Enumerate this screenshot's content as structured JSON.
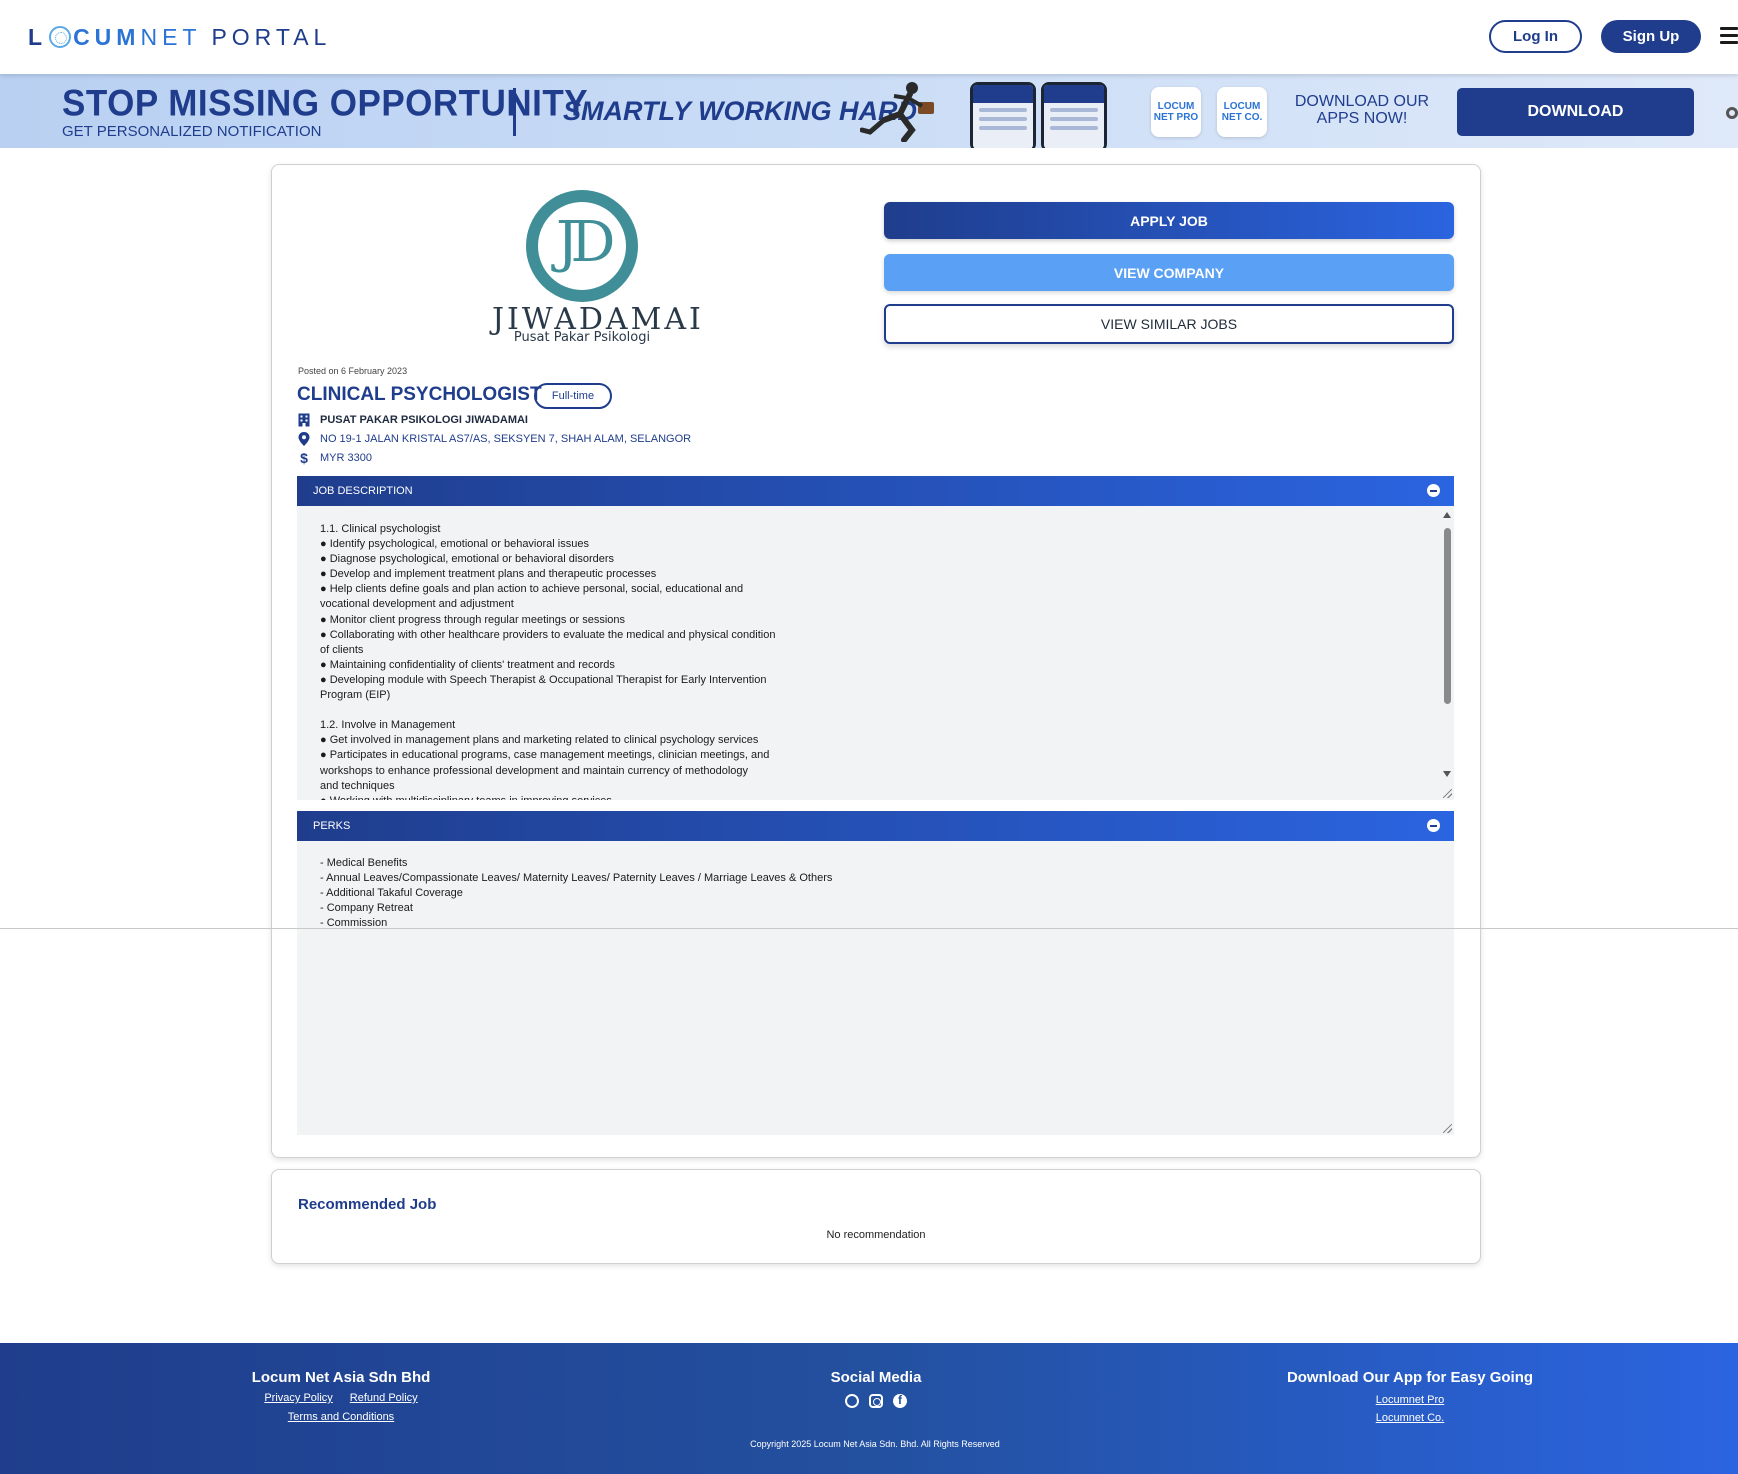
{
  "header": {
    "logo": {
      "part1": "L",
      "part2": "CUM",
      "part3": "NET",
      "part4": "PORTAL"
    },
    "login_label": "Log In",
    "signup_label": "Sign Up",
    "menu_icon": "hamburger-icon"
  },
  "banner": {
    "headline": "STOP MISSING OPPORTUNITY",
    "subheadline": "GET PERSONALIZED NOTIFICATION",
    "tagline": "SMARTLY WORKING HARD",
    "app_pro_label": "LOCUM NET PRO",
    "app_co_label": "LOCUM NET CO.",
    "download_text": "DOWNLOAD OUR APPS NOW!",
    "download_button": "DOWNLOAD"
  },
  "company_logo": {
    "monogram": "JD",
    "name": "JIWADAMAI",
    "subtitle": "Pusat Pakar Psikologi"
  },
  "actions": {
    "apply": "APPLY JOB",
    "view_company": "VIEW COMPANY",
    "view_similar": "VIEW SIMILAR JOBS"
  },
  "job": {
    "posted": "Posted on 6 February 2023",
    "title": "CLINICAL PSYCHOLOGIST",
    "type": "Full-time",
    "company": "PUSAT PAKAR PSIKOLOGI JIWADAMAI",
    "address": "NO 19-1 JALAN KRISTAL AS7/AS, SEKSYEN 7, SHAH ALAM, SELANGOR",
    "salary": "MYR 3300"
  },
  "description": {
    "heading": "JOB DESCRIPTION",
    "lines": [
      "1.1. Clinical psychologist",
      "● Identify psychological, emotional or behavioral issues",
      "● Diagnose psychological, emotional or behavioral disorders",
      "● Develop and implement treatment plans and therapeutic processes",
      "● Help clients define goals and plan action to achieve personal, social, educational and",
      "vocational development and adjustment",
      "● Monitor client progress through regular meetings or sessions",
      "● Collaborating with other healthcare providers to evaluate the medical and physical condition",
      "of clients",
      "● Maintaining confidentiality of clients' treatment and records",
      "● Developing module with Speech Therapist & Occupational Therapist for Early Intervention",
      "Program (EIP)",
      "",
      "1.2. Involve in Management",
      "● Get involved in management plans and marketing related to clinical psychology services",
      "● Participates in educational programs, case management meetings, clinician meetings, and",
      "workshops to enhance professional development and maintain currency of methodology",
      "and techniques",
      "● Working with multidisciplinary teams in improving services"
    ]
  },
  "perks": {
    "heading": "PERKS",
    "lines": [
      "- Medical Benefits",
      "- Annual Leaves/Compassionate Leaves/ Maternity Leaves/ Paternity Leaves / Marriage Leaves & Others",
      "- Additional Takaful Coverage",
      "- Company Retreat",
      "- Commission"
    ]
  },
  "recommended": {
    "title": "Recommended Job",
    "empty": "No recommendation"
  },
  "footer": {
    "company": "Locum Net Asia Sdn Bhd",
    "privacy": "Privacy Policy",
    "refund": "Refund Policy",
    "terms": "Terms and Conditions",
    "social_title": "Social Media",
    "app_title": "Download Our App for Easy Going",
    "app_pro": "Locumnet Pro",
    "app_co": "Locumnet Co.",
    "copyright": "Copyright 2025 Locum Net Asia Sdn. Bhd. All Rights Reserved"
  },
  "colors": {
    "primary": "#1f3d8c",
    "accent": "#2b64e0",
    "light_button": "#5aa0f5",
    "textbox_bg": "#f2f3f5"
  }
}
